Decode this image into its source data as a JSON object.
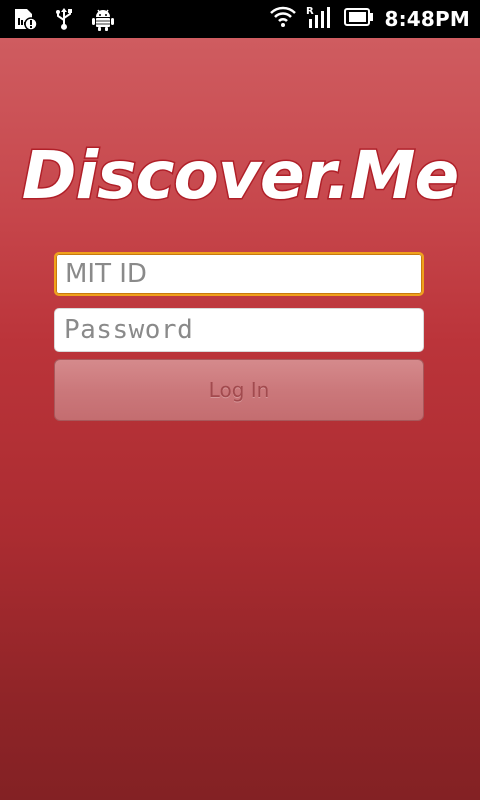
{
  "status_bar": {
    "time": "8:48PM",
    "icons": [
      "sd-card-warning-icon",
      "usb-icon",
      "android-debug-icon",
      "wifi-icon",
      "roaming-signal-icon",
      "battery-icon"
    ]
  },
  "app": {
    "logo_text": "Discover.Me",
    "login_form": {
      "username_placeholder": "MIT ID",
      "username_value": "",
      "password_placeholder": "Password",
      "password_value": "",
      "login_label": "Log In"
    }
  },
  "colors": {
    "background_top": "#cf5c60",
    "background_bottom": "#832124",
    "focus_ring": "#f0a11c",
    "logo_outline": "#b01f28"
  }
}
